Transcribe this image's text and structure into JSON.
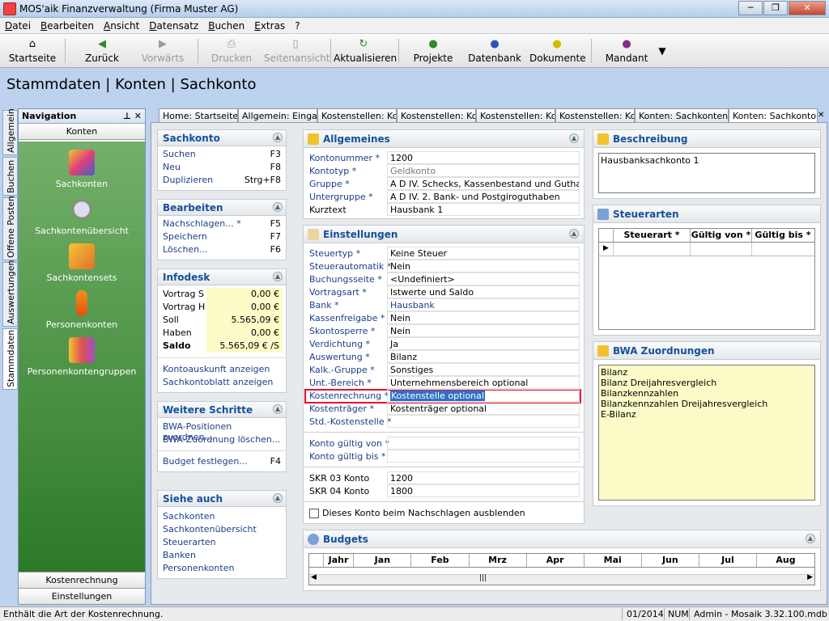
{
  "window": {
    "title": "MOS'aik Finanzverwaltung (Firma Muster AG)"
  },
  "menu": [
    "Datei",
    "Bearbeiten",
    "Ansicht",
    "Datensatz",
    "Buchen",
    "Extras",
    "?"
  ],
  "toolbar": {
    "startseite": "Startseite",
    "zurueck": "Zurück",
    "vorwaerts": "Vorwärts",
    "drucken": "Drucken",
    "seitenansicht": "Seitenansicht",
    "aktualisieren": "Aktualisieren",
    "projekte": "Projekte",
    "datenbank": "Datenbank",
    "dokumente": "Dokumente",
    "mandant": "Mandant"
  },
  "page_title": "Stammdaten | Konten | Sachkonto",
  "vertical_tabs": [
    "Allgemein",
    "Buchen",
    "Offene Posten",
    "Auswertungen",
    "Stammdaten"
  ],
  "nav": {
    "header": "Navigation",
    "section": "Konten",
    "items": [
      "Sachkonten",
      "Sachkontenübersicht",
      "Sachkontensets",
      "Personenkonten",
      "Personenkontengruppen"
    ],
    "bottom": [
      "Kostenrechnung",
      "Einstellungen"
    ]
  },
  "tabs": [
    "Home: Startseite",
    "Allgemein: Eingang",
    "Kostenstellen: Kos",
    "Kostenstellen: Kos",
    "Kostenstellen: Kos",
    "Kostenstellen: Kos",
    "Konten: Sachkonten",
    "Konten: Sachkonto"
  ],
  "left": {
    "sachkonto": {
      "title": "Sachkonto",
      "rows": [
        {
          "label": "Suchen",
          "key": "F3"
        },
        {
          "label": "Neu",
          "key": "F8"
        },
        {
          "label": "Duplizieren",
          "key": "Strg+F8"
        }
      ]
    },
    "bearbeiten": {
      "title": "Bearbeiten",
      "rows": [
        {
          "label": "Nachschlagen... *",
          "key": "F5"
        },
        {
          "label": "Speichern",
          "key": "F7"
        },
        {
          "label": "Löschen...",
          "key": "F6"
        }
      ]
    },
    "infodesk": {
      "title": "Infodesk",
      "rows": [
        {
          "label": "Vortrag S",
          "value": "0,00 €"
        },
        {
          "label": "Vortrag H",
          "value": "0,00 €"
        },
        {
          "label": "Soll",
          "value": "5.565,09 €"
        },
        {
          "label": "Haben",
          "value": "0,00 €"
        },
        {
          "label": "Saldo",
          "value": "5.565,09 € /S"
        }
      ],
      "links": [
        "Kontoauskunft anzeigen",
        "Sachkontoblatt anzeigen"
      ]
    },
    "weitere": {
      "title": "Weitere Schritte",
      "rows": [
        {
          "label": "BWA-Positionen zuordnen...",
          "key": ""
        },
        {
          "label": "BWA-Zuordnung löschen...",
          "key": ""
        },
        {
          "label": "Budget festlegen...",
          "key": "F4"
        }
      ]
    },
    "siehe": {
      "title": "Siehe auch",
      "rows": [
        "Sachkonten",
        "Sachkontenübersicht",
        "Steuerarten",
        "Banken",
        "Personenkonten"
      ]
    }
  },
  "allgemeines": {
    "title": "Allgemeines",
    "fields": [
      {
        "label": "Kontonummer *",
        "value": "1200"
      },
      {
        "label": "Kontotyp *",
        "value": "Geldkonto"
      },
      {
        "label": "Gruppe *",
        "value": "A D IV. Schecks, Kassenbestand und Guthaben"
      },
      {
        "label": "Untergruppe *",
        "value": "A D IV. 2. Bank- und Postgiroguthaben"
      },
      {
        "label": "Kurztext",
        "value": "Hausbank 1"
      }
    ]
  },
  "einstellungen": {
    "title": "Einstellungen",
    "fields": [
      {
        "label": "Steuertyp *",
        "value": "Keine Steuer"
      },
      {
        "label": "Steuerautomatik *",
        "value": "Nein"
      },
      {
        "label": "Buchungsseite *",
        "value": "<Undefiniert>"
      },
      {
        "label": "Vortragsart *",
        "value": "Istwerte und Saldo"
      },
      {
        "label": "Bank *",
        "value": "Hausbank"
      },
      {
        "label": "Kassenfreigabe *",
        "value": "Nein"
      },
      {
        "label": "Skontosperre *",
        "value": "Nein"
      },
      {
        "label": "Verdichtung *",
        "value": "Ja"
      },
      {
        "label": "Auswertung *",
        "value": "Bilanz"
      },
      {
        "label": "Kalk.-Gruppe *",
        "value": "Sonstiges"
      },
      {
        "label": "Unt.-Bereich *",
        "value": "Unternehmensbereich optional"
      },
      {
        "label": "Kostenrechnung *",
        "value": "Kostenstelle optional"
      },
      {
        "label": "Kostenträger *",
        "value": "Kostenträger optional"
      },
      {
        "label": "Std.-Kostenstelle *",
        "value": ""
      }
    ],
    "gueltig": [
      {
        "label": "Konto gültig von *",
        "value": ""
      },
      {
        "label": "Konto gültig bis *",
        "value": ""
      }
    ],
    "skr": [
      {
        "label": "SKR 03 Konto",
        "value": "1200"
      },
      {
        "label": "SKR 04 Konto",
        "value": "1800"
      }
    ],
    "checkbox": "Dieses Konto beim Nachschlagen ausblenden"
  },
  "budgets": {
    "title": "Budgets",
    "columns": [
      "Jahr",
      "Jan",
      "Feb",
      "Mrz",
      "Apr",
      "Mai",
      "Jun",
      "Jul",
      "Aug"
    ]
  },
  "beschreibung": {
    "title": "Beschreibung",
    "text": "Hausbanksachkonto 1"
  },
  "steuerarten": {
    "title": "Steuerarten",
    "columns": [
      "Steuerart *",
      "Gültig von *",
      "Gültig bis *"
    ]
  },
  "bwa": {
    "title": "BWA Zuordnungen",
    "items": [
      "Bilanz",
      "Bilanz Dreijahresvergleich",
      "Bilanzkennzahlen",
      "Bilanzkennzahlen Dreijahresvergleich",
      "E-Bilanz"
    ]
  },
  "status": {
    "message": "Enthält die Art der Kostenrechnung.",
    "period": "01/2014",
    "num": "NUM",
    "user": "Admin - Mosaik 3.32.100.mdb"
  },
  "colors": {
    "accent": "#16509a",
    "nav_green": "#3e8c36",
    "highlight": "#e8102a",
    "selection": "#3170c8"
  }
}
